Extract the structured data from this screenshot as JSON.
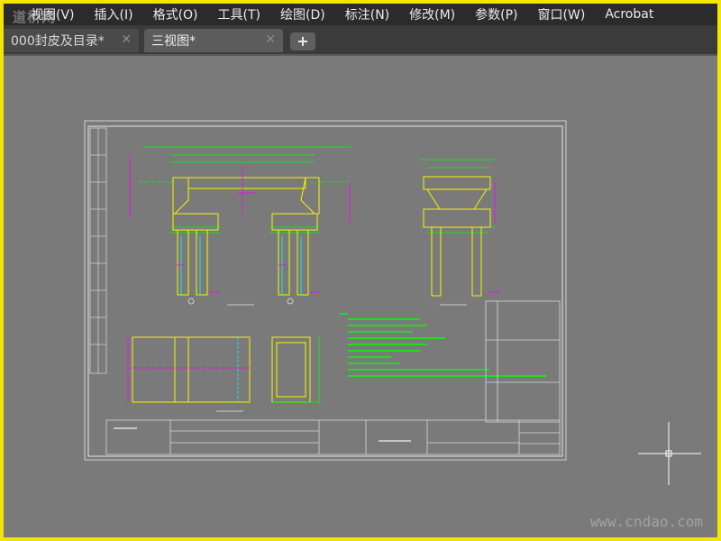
{
  "watermark_top": "道桥网",
  "menu": [
    "视图(V)",
    "插入(I)",
    "格式(O)",
    "工具(T)",
    "绘图(D)",
    "标注(N)",
    "修改(M)",
    "参数(P)",
    "窗口(W)",
    "Acrobat"
  ],
  "tabs": [
    {
      "label": "000封皮及目录*",
      "close": "✕"
    },
    {
      "label": "三视图*",
      "close": "✕"
    }
  ],
  "new_tab": "+",
  "watermark_bottom": "www.cndao.com",
  "colors": {
    "frame": "#f2e600",
    "cad_yellow": "#f5f500",
    "cad_green": "#00ff00",
    "cad_magenta": "#ff00ff",
    "cad_cyan": "#00ffff",
    "cad_white": "#e6e6e6"
  }
}
